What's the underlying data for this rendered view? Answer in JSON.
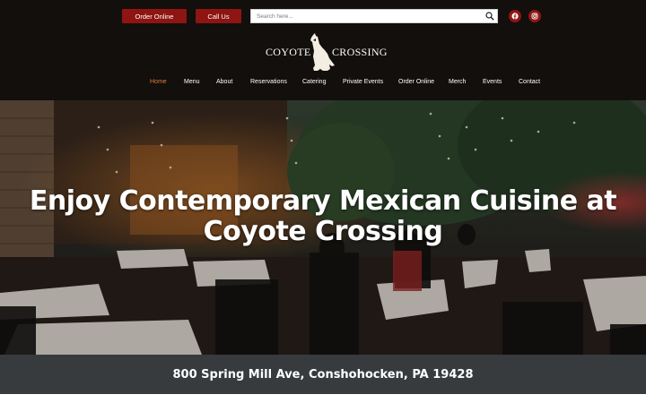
{
  "header": {
    "order_online_button": "Order Online",
    "call_us_button": "Call Us",
    "search": {
      "placeholder": "Search here...",
      "value": ""
    },
    "social": [
      {
        "icon": "facebook-icon"
      },
      {
        "icon": "instagram-icon"
      }
    ],
    "logo": {
      "left_text": "COYOTE",
      "right_text": "CROSSING",
      "icon": "howling-coyote-icon"
    }
  },
  "nav": {
    "items": [
      {
        "label": "Home",
        "active": true
      },
      {
        "label": "Menu"
      },
      {
        "label": "About"
      },
      {
        "label": "Reservations"
      },
      {
        "label": "Catering"
      },
      {
        "label": "Private Events"
      },
      {
        "label": "Order Online"
      },
      {
        "label": "Merch"
      },
      {
        "label": "Events"
      },
      {
        "label": "Contact"
      }
    ]
  },
  "hero": {
    "title_line1": "Enjoy Contemporary Mexican Cuisine at",
    "title_line2": "Coyote Crossing"
  },
  "footer": {
    "address": "800 Spring Mill Ave, Conshohocken, PA 19428"
  },
  "colors": {
    "header_bg": "#120f0d",
    "accent_red": "#8e1512",
    "nav_active": "#e0793e",
    "address_bar": "#373b3e"
  }
}
